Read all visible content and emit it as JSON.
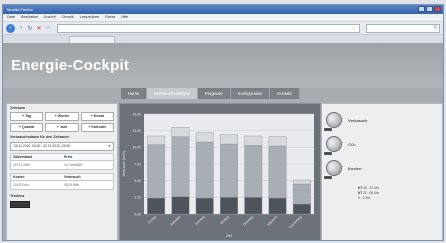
{
  "browser": {
    "title": "Mozilla Firefox",
    "menu": [
      "Datei",
      "Bearbeiten",
      "Ansicht",
      "Chronik",
      "Lesezeichen",
      "Extras",
      "Hilfe"
    ]
  },
  "app": {
    "title": "Energie-Cockpit",
    "nav": [
      "Home",
      "Verbrauchsanalyse",
      "Prognose",
      "Konfiguration",
      "Kontakt"
    ],
    "active_nav": "Verbrauchsanalyse"
  },
  "left_panel": {
    "zeitraum_label": "Zeitraum",
    "buttons_row1": [
      "+ Tag",
      "+ Woche",
      "+ Monat"
    ],
    "buttons_row2": [
      "+ Quartal",
      "+ Jahr",
      "+ Kalender"
    ],
    "auswahl_label": "Verbrauchsdaten für den Zeitraum:",
    "date_range": "26.11.2010, 00:00 - 02.12.2010, 23:59",
    "table1": {
      "h1": "Zählerstand",
      "h2": "Preis",
      "v1": "1573,0 kWh",
      "v2": "14 Cent/kWh"
    },
    "table2": {
      "h1": "Kosten",
      "h2": "Verbrauch",
      "v1": "13,00 Euro",
      "v2": "95,20 kWh"
    },
    "tendenz_label": "Tendenz"
  },
  "right_panel": {
    "items": [
      "Verbrauch",
      "CO₂",
      "Kosten"
    ],
    "legend": [
      {
        "label": "HT",
        "range": "06 - 22 Uhr"
      },
      {
        "label": "NT",
        "range": "22 - 06 Uhr"
      },
      {
        "label": "",
        "range": "0 - 0 Uhr"
      }
    ]
  },
  "chart_data": {
    "type": "bar",
    "stacked": true,
    "categories": [
      "Freitag",
      "Samstag",
      "Sonntag",
      "Montag",
      "Dienstag",
      "Mittwoch",
      "Donnerstag"
    ],
    "series": [
      {
        "values": [
          2.4,
          2.6,
          2.4,
          2.5,
          2.5,
          2.4,
          1.5
        ]
      },
      {
        "values": [
          8.0,
          9.0,
          8.4,
          8.0,
          7.8,
          7.8,
          3.0
        ]
      },
      {
        "values": [
          1.3,
          1.4,
          1.4,
          1.4,
          1.4,
          1.4,
          0.6
        ]
      }
    ],
    "yticks": [
      "0,00",
      "2,50",
      "5,00",
      "7,50",
      "10,00",
      "12,50",
      "15,00"
    ],
    "ylim": [
      0,
      15
    ],
    "ylabel": "Verbrauch [kWh]",
    "xlabel": "Zeit",
    "grid": true
  }
}
